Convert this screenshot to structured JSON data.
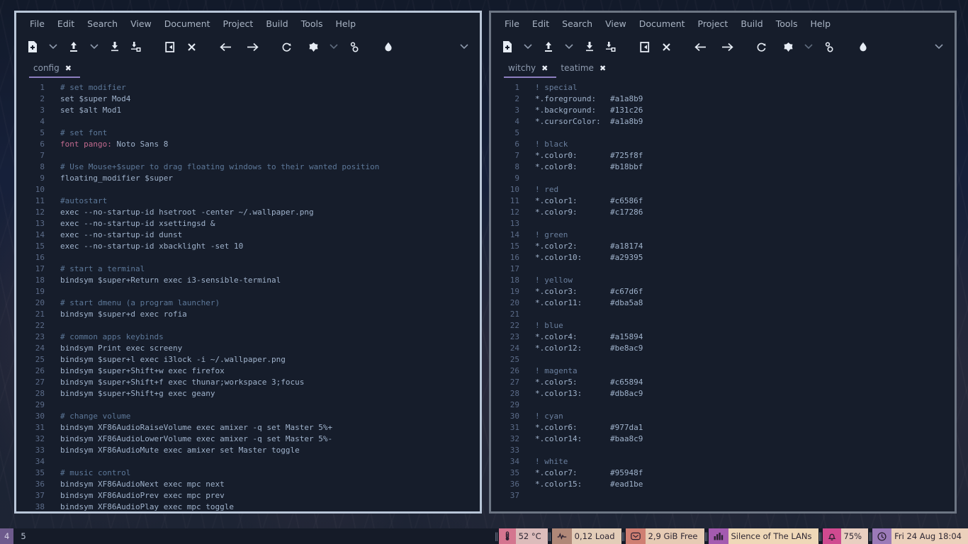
{
  "desktop": {
    "workspace_number": "4",
    "window_title": "5"
  },
  "menu": [
    "File",
    "Edit",
    "Search",
    "View",
    "Document",
    "Project",
    "Build",
    "Tools",
    "Help"
  ],
  "toolbar_icons": [
    "new-document-icon",
    "chevron-down-icon",
    "open-document-icon",
    "chevron-down-icon",
    "save-document-icon",
    "save-all-icon",
    "revert-icon",
    "close-document-icon",
    "back-arrow-icon",
    "forward-arrow-icon",
    "rebuild-icon",
    "build-icon",
    "chevron-down-icon",
    "preferences-icon",
    "color-picker-icon",
    "toolbar-overflow-icon"
  ],
  "left_window": {
    "active": true,
    "tabs": [
      {
        "label": "config",
        "active": true,
        "close_icon": "close-icon"
      }
    ],
    "lines": [
      {
        "n": "1",
        "parts": [
          {
            "t": "# set modifier",
            "c": "c-comment"
          }
        ]
      },
      {
        "n": "2",
        "parts": [
          {
            "t": "set $super Mod4",
            "c": "c-plain"
          }
        ]
      },
      {
        "n": "3",
        "parts": [
          {
            "t": "set $alt Mod1",
            "c": "c-plain"
          }
        ]
      },
      {
        "n": "4",
        "parts": []
      },
      {
        "n": "5",
        "parts": [
          {
            "t": "# set font",
            "c": "c-comment"
          }
        ]
      },
      {
        "n": "6",
        "parts": [
          {
            "t": "font pango",
            "c": "c-key"
          },
          {
            "t": ":",
            "c": "c-punct"
          },
          {
            "t": " Noto Sans 8",
            "c": "c-plain"
          }
        ]
      },
      {
        "n": "7",
        "parts": []
      },
      {
        "n": "8",
        "parts": [
          {
            "t": "# Use Mouse+$super to drag floating windows to their wanted position",
            "c": "c-comment"
          }
        ]
      },
      {
        "n": "9",
        "parts": [
          {
            "t": "floating_modifier $super",
            "c": "c-plain"
          }
        ]
      },
      {
        "n": "10",
        "parts": []
      },
      {
        "n": "11",
        "parts": [
          {
            "t": "#autostart",
            "c": "c-comment"
          }
        ]
      },
      {
        "n": "12",
        "parts": [
          {
            "t": "exec --no-startup-id hsetroot -center ~/.wallpaper.png",
            "c": "c-plain"
          }
        ]
      },
      {
        "n": "13",
        "parts": [
          {
            "t": "exec --no-startup-id xsettingsd &",
            "c": "c-plain"
          }
        ]
      },
      {
        "n": "14",
        "parts": [
          {
            "t": "exec --no-startup-id dunst",
            "c": "c-plain"
          }
        ]
      },
      {
        "n": "15",
        "parts": [
          {
            "t": "exec --no-startup-id xbacklight -set 10",
            "c": "c-plain"
          }
        ]
      },
      {
        "n": "16",
        "parts": []
      },
      {
        "n": "17",
        "parts": [
          {
            "t": "# start a terminal",
            "c": "c-comment"
          }
        ]
      },
      {
        "n": "18",
        "parts": [
          {
            "t": "bindsym $super+Return exec i3-sensible-terminal",
            "c": "c-plain"
          }
        ]
      },
      {
        "n": "19",
        "parts": []
      },
      {
        "n": "20",
        "parts": [
          {
            "t": "# start dmenu (a program launcher)",
            "c": "c-comment"
          }
        ]
      },
      {
        "n": "21",
        "parts": [
          {
            "t": "bindsym $super+d exec rofia",
            "c": "c-plain"
          }
        ]
      },
      {
        "n": "22",
        "parts": []
      },
      {
        "n": "23",
        "parts": [
          {
            "t": "# common apps keybinds",
            "c": "c-comment"
          }
        ]
      },
      {
        "n": "24",
        "parts": [
          {
            "t": "bindsym Print exec screeny",
            "c": "c-plain"
          }
        ]
      },
      {
        "n": "25",
        "parts": [
          {
            "t": "bindsym $super+l exec i3lock -i ~/.wallpaper.png",
            "c": "c-plain"
          }
        ]
      },
      {
        "n": "26",
        "parts": [
          {
            "t": "bindsym $super+Shift+w exec firefox",
            "c": "c-plain"
          }
        ]
      },
      {
        "n": "27",
        "parts": [
          {
            "t": "bindsym $super+Shift+f exec thunar;workspace 3;focus",
            "c": "c-plain"
          }
        ]
      },
      {
        "n": "28",
        "parts": [
          {
            "t": "bindsym $super+Shift+g exec geany",
            "c": "c-plain"
          }
        ]
      },
      {
        "n": "29",
        "parts": []
      },
      {
        "n": "30",
        "parts": [
          {
            "t": "# change volume",
            "c": "c-comment"
          }
        ]
      },
      {
        "n": "31",
        "parts": [
          {
            "t": "bindsym XF86AudioRaiseVolume exec amixer -q set Master 5%+",
            "c": "c-plain"
          }
        ]
      },
      {
        "n": "32",
        "parts": [
          {
            "t": "bindsym XF86AudioLowerVolume exec amixer -q set Master 5%-",
            "c": "c-plain"
          }
        ]
      },
      {
        "n": "33",
        "parts": [
          {
            "t": "bindsym XF86AudioMute exec amixer set Master toggle",
            "c": "c-plain"
          }
        ]
      },
      {
        "n": "34",
        "parts": []
      },
      {
        "n": "35",
        "parts": [
          {
            "t": "# music control",
            "c": "c-comment"
          }
        ]
      },
      {
        "n": "36",
        "parts": [
          {
            "t": "bindsym XF86AudioNext exec mpc next",
            "c": "c-plain"
          }
        ]
      },
      {
        "n": "37",
        "parts": [
          {
            "t": "bindsym XF86AudioPrev exec mpc prev",
            "c": "c-plain"
          }
        ]
      },
      {
        "n": "38",
        "parts": [
          {
            "t": "bindsym XF86AudioPlay exec mpc toggle",
            "c": "c-plain"
          }
        ]
      }
    ]
  },
  "right_window": {
    "active": false,
    "tabs": [
      {
        "label": "witchy",
        "active": true,
        "close_icon": "close-icon"
      },
      {
        "label": "teatime",
        "active": false,
        "close_icon": "close-icon"
      }
    ],
    "lines": [
      {
        "n": "1",
        "parts": [
          {
            "t": "! special",
            "c": "c-bang"
          }
        ]
      },
      {
        "n": "2",
        "parts": [
          {
            "t": "*.foreground:   #a1a8b9",
            "c": "c-val"
          }
        ]
      },
      {
        "n": "3",
        "parts": [
          {
            "t": "*.background:   #131c26",
            "c": "c-val"
          }
        ]
      },
      {
        "n": "4",
        "parts": [
          {
            "t": "*.cursorColor:  #a1a8b9",
            "c": "c-val"
          }
        ]
      },
      {
        "n": "5",
        "parts": []
      },
      {
        "n": "6",
        "parts": [
          {
            "t": "! black",
            "c": "c-bang"
          }
        ]
      },
      {
        "n": "7",
        "parts": [
          {
            "t": "*.color0:       #725f8f",
            "c": "c-val"
          }
        ]
      },
      {
        "n": "8",
        "parts": [
          {
            "t": "*.color8:       #b18bbf",
            "c": "c-val"
          }
        ]
      },
      {
        "n": "9",
        "parts": []
      },
      {
        "n": "10",
        "parts": [
          {
            "t": "! red",
            "c": "c-bang"
          }
        ]
      },
      {
        "n": "11",
        "parts": [
          {
            "t": "*.color1:       #c6586f",
            "c": "c-val"
          }
        ]
      },
      {
        "n": "12",
        "parts": [
          {
            "t": "*.color9:       #c17286",
            "c": "c-val"
          }
        ]
      },
      {
        "n": "13",
        "parts": []
      },
      {
        "n": "14",
        "parts": [
          {
            "t": "! green",
            "c": "c-bang"
          }
        ]
      },
      {
        "n": "15",
        "parts": [
          {
            "t": "*.color2:       #a18174",
            "c": "c-val"
          }
        ]
      },
      {
        "n": "16",
        "parts": [
          {
            "t": "*.color10:      #a29395",
            "c": "c-val"
          }
        ]
      },
      {
        "n": "17",
        "parts": []
      },
      {
        "n": "18",
        "parts": [
          {
            "t": "! yellow",
            "c": "c-bang"
          }
        ]
      },
      {
        "n": "19",
        "parts": [
          {
            "t": "*.color3:       #c67d6f",
            "c": "c-val"
          }
        ]
      },
      {
        "n": "20",
        "parts": [
          {
            "t": "*.color11:      #dba5a8",
            "c": "c-val"
          }
        ]
      },
      {
        "n": "21",
        "parts": []
      },
      {
        "n": "22",
        "parts": [
          {
            "t": "! blue",
            "c": "c-bang"
          }
        ]
      },
      {
        "n": "23",
        "parts": [
          {
            "t": "*.color4:       #a15894",
            "c": "c-val"
          }
        ]
      },
      {
        "n": "24",
        "parts": [
          {
            "t": "*.color12:      #be8ac9",
            "c": "c-val"
          }
        ]
      },
      {
        "n": "25",
        "parts": []
      },
      {
        "n": "26",
        "parts": [
          {
            "t": "! magenta",
            "c": "c-bang"
          }
        ]
      },
      {
        "n": "27",
        "parts": [
          {
            "t": "*.color5:       #c65894",
            "c": "c-val"
          }
        ]
      },
      {
        "n": "28",
        "parts": [
          {
            "t": "*.color13:      #db8ac9",
            "c": "c-val"
          }
        ]
      },
      {
        "n": "29",
        "parts": []
      },
      {
        "n": "30",
        "parts": [
          {
            "t": "! cyan",
            "c": "c-bang"
          }
        ]
      },
      {
        "n": "31",
        "parts": [
          {
            "t": "*.color6:       #977da1",
            "c": "c-val"
          }
        ]
      },
      {
        "n": "32",
        "parts": [
          {
            "t": "*.color14:      #baa8c9",
            "c": "c-val"
          }
        ]
      },
      {
        "n": "33",
        "parts": []
      },
      {
        "n": "34",
        "parts": [
          {
            "t": "! white",
            "c": "c-bang"
          }
        ]
      },
      {
        "n": "35",
        "parts": [
          {
            "t": "*.color7:       #95948f",
            "c": "c-val"
          }
        ]
      },
      {
        "n": "36",
        "parts": [
          {
            "t": "*.color15:      #ead1be",
            "c": "c-val"
          }
        ]
      },
      {
        "n": "37",
        "parts": []
      }
    ]
  },
  "statusbar": {
    "blocks": [
      {
        "name": "temperature",
        "icon": "thermometer-icon",
        "label": "52 °C",
        "icon_bg": "#d4758f",
        "label_bg": "#dcbcbb"
      },
      {
        "name": "cpu-load",
        "icon": "pulse-icon",
        "label": "0,12 Load",
        "icon_bg": "#b08878",
        "label_bg": "#e3cdb8"
      },
      {
        "name": "disk-free",
        "icon": "disk-icon",
        "label": "2,9 GiB Free",
        "icon_bg": "#cf7f72",
        "label_bg": "#e6cbb4"
      },
      {
        "name": "now-playing",
        "icon": "music-bars-icon",
        "label": "Silence of The LANs",
        "icon_bg": "#a45bb0",
        "label_bg": "#efd8b8"
      },
      {
        "name": "volume",
        "icon": "bell-icon",
        "label": "75%",
        "icon_bg": "#d04a90",
        "label_bg": "#e9cfc1"
      },
      {
        "name": "clock",
        "icon": "clock-icon",
        "label": "Fri 24 Aug 18:04",
        "icon_bg": "#9b7ab8",
        "label_bg": "#ecd1bc"
      }
    ]
  }
}
